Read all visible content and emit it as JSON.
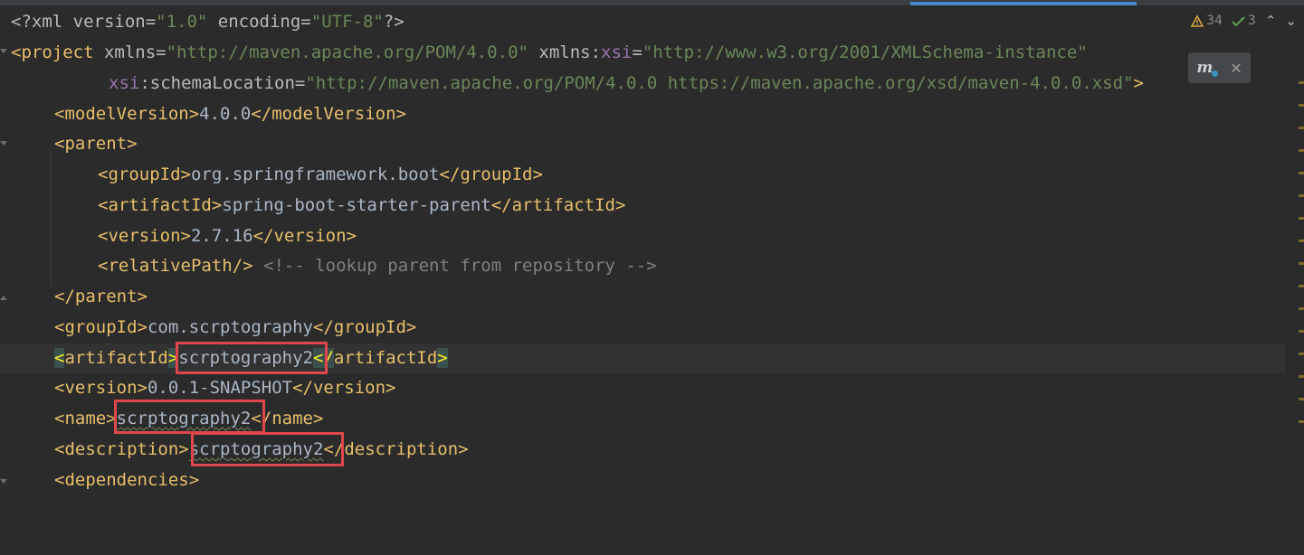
{
  "inspections": {
    "warnings": "34",
    "ok": "3"
  },
  "line1": {
    "open": "<?xml version=",
    "v1": "\"1.0\"",
    "mid": " encoding=",
    "v2": "\"UTF-8\"",
    "close": "?>"
  },
  "line2": {
    "open": "<project",
    "a1": " xmlns=",
    "v1": "\"http://maven.apache.org/POM/4.0.0\"",
    "a2": " xmlns:",
    "ns": "xsi",
    "eq": "=",
    "v2": "\"http://www.w3.org/2001/XMLSchema-instance\""
  },
  "line3": {
    "ns": "xsi",
    "attr": ":schemaLocation=",
    "v": "\"http://maven.apache.org/POM/4.0.0 https://maven.apache.org/xsd/maven-4.0.0.xsd\"",
    "close": ">"
  },
  "line4": {
    "open": "<modelVersion>",
    "text": "4.0.0",
    "close": "</modelVersion>"
  },
  "line5": {
    "open": "<parent>"
  },
  "line6": {
    "open": "<groupId>",
    "text": "org.springframework.boot",
    "close": "</groupId>"
  },
  "line7": {
    "open": "<artifactId>",
    "text": "spring-boot-starter-parent",
    "close": "</artifactId>"
  },
  "line8": {
    "open": "<version>",
    "text": "2.7.16",
    "close": "</version>"
  },
  "line9": {
    "open": "<relativePath/>",
    "comment": " <!-- lookup parent from repository -->"
  },
  "line10": {
    "close": "</parent>"
  },
  "line11": {
    "open": "<groupId>",
    "text": "com.scrptography",
    "close": "</groupId>"
  },
  "line12": {
    "lt": "<",
    "name": "artifactId",
    "gt": ">",
    "text": "scrptography2",
    "close_lt": "</",
    "close_name": "artifactId",
    "close_gt": ">"
  },
  "line13": {
    "open": "<version>",
    "text": "0.0.1-SNAPSHOT",
    "close": "</version>"
  },
  "line14": {
    "open": "<name>",
    "text": "scrptography2",
    "close": "</name>"
  },
  "line15": {
    "open": "<description>",
    "text": "scrptography2",
    "close": "</description>"
  },
  "line16": {
    "open": "<dependencies>"
  },
  "colors": {
    "highlight_box": "#e0474a",
    "tag": "#e8bf6a",
    "string": "#6a8759",
    "namespace": "#9876aa"
  }
}
